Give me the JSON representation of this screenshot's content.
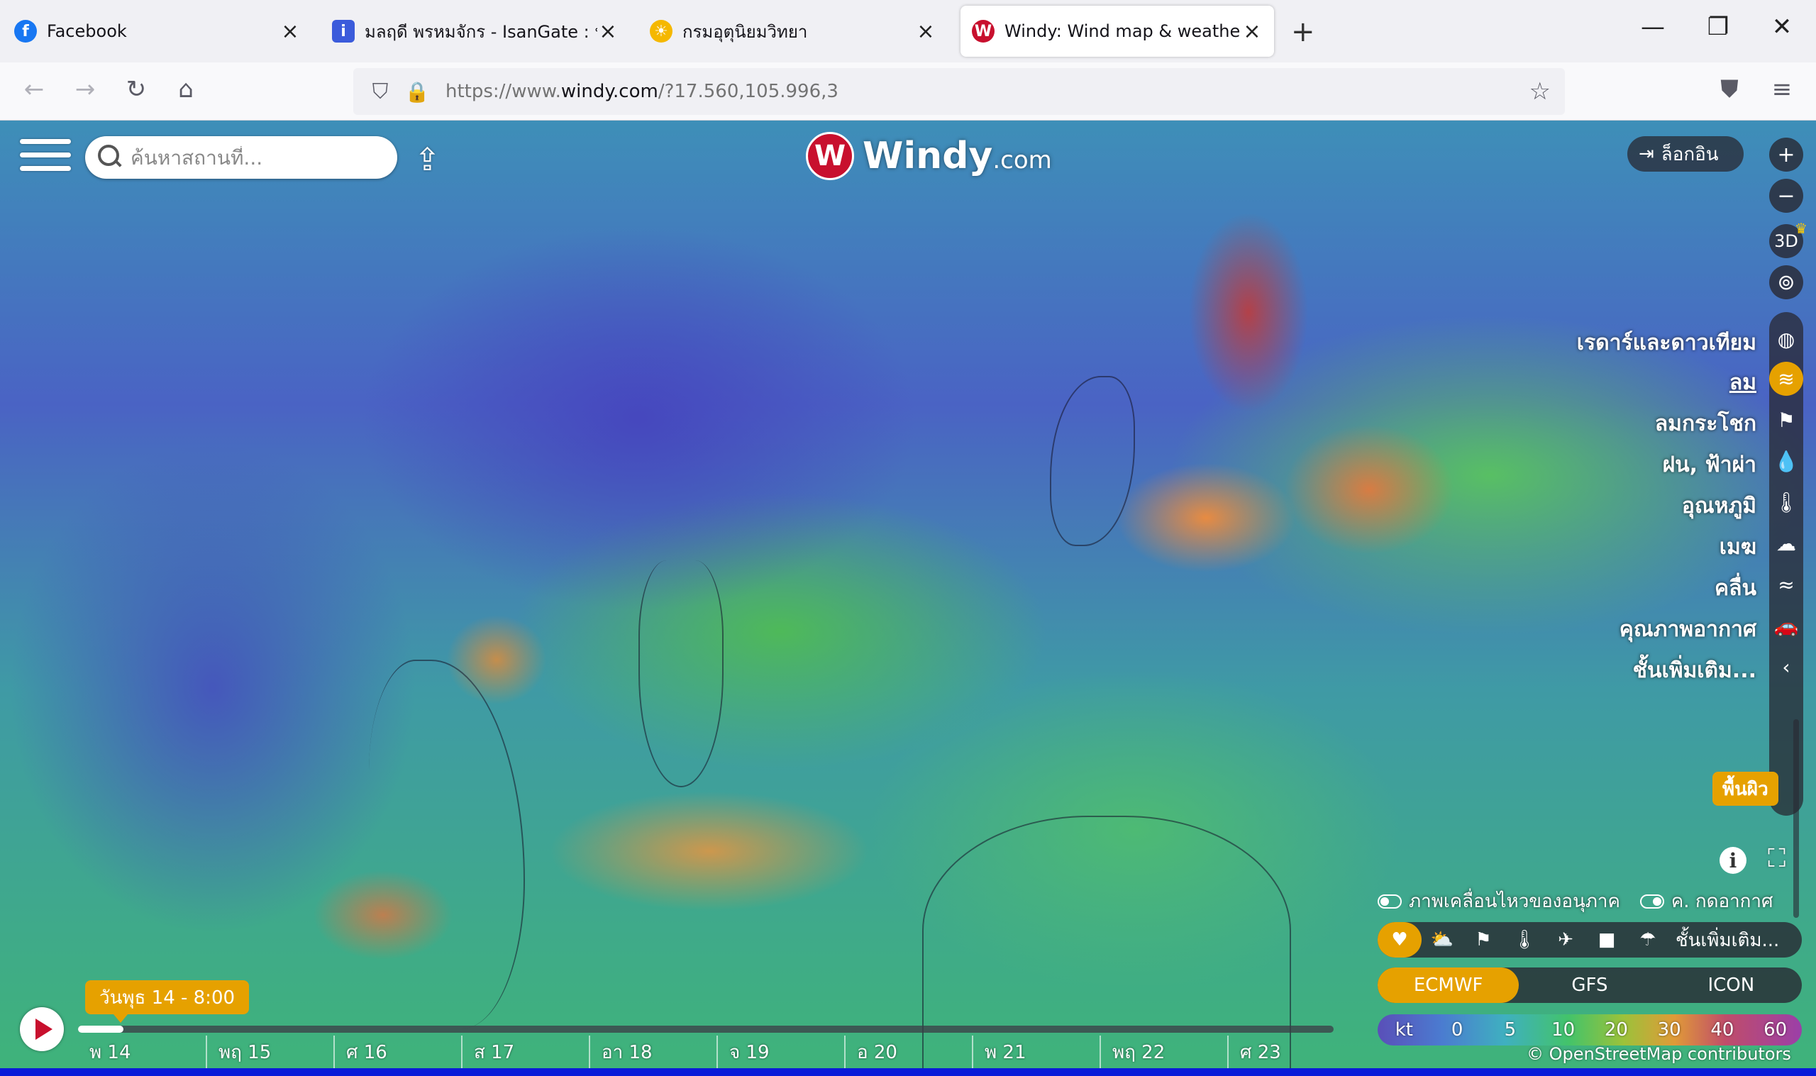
{
  "browser": {
    "tabs": [
      {
        "label": "Facebook",
        "favicon": "facebook-icon",
        "color": "#1877f2"
      },
      {
        "label": "มลฤดี พรหมจักร - IsanGate : ประ",
        "favicon": "isangate-icon",
        "color": "#3b5bdb"
      },
      {
        "label": "กรมอุตุนิยมวิทยา",
        "favicon": "sun-icon",
        "color": "#f5b800"
      },
      {
        "label": "Windy: Wind map & weather fo",
        "favicon": "windy-icon",
        "color": "#c8102e"
      }
    ],
    "url_prefix": "https://www.",
    "url_domain": "windy.com",
    "url_suffix": "/?17.560,105.996,3"
  },
  "map": {
    "search_placeholder": "ค้นหาสถานที่...",
    "logo_text": "Windy",
    "logo_suffix": ".com",
    "login_label": "ล็อกอิน",
    "btn_3d": "3D",
    "layers": [
      {
        "label": "เรดาร์และดาวเทียม",
        "icon": "globe-icon"
      },
      {
        "label": "ลม",
        "icon": "wind-icon",
        "selected": true
      },
      {
        "label": "ลมกระโชก",
        "icon": "flag-icon"
      },
      {
        "label": "ฝน, ฟ้าผ่า",
        "icon": "drop-icon"
      },
      {
        "label": "อุณหภูมิ",
        "icon": "thermometer-icon"
      },
      {
        "label": "เมฆ",
        "icon": "cloud-icon"
      },
      {
        "label": "คลื่น",
        "icon": "waves-icon"
      },
      {
        "label": "คุณภาพอากาศ",
        "icon": "car-icon"
      },
      {
        "label": "ชั้นเพิ่มเติม...",
        "icon": "chevron-left-icon"
      }
    ],
    "altitude_label": "พื้นผิว",
    "toggle_particles": "ภาพเคลื่อนไหวของอนุภาค",
    "toggle_pressure": "ค. กดอากาศ",
    "quick_more": "ชั้นเพิ่มเติม...",
    "models": [
      "ECMWF",
      "GFS",
      "ICON"
    ],
    "legend_unit": "kt",
    "legend_values": [
      "0",
      "5",
      "10",
      "20",
      "30",
      "40",
      "60"
    ],
    "attribution": "© OpenStreetMap contributors",
    "time_label": "วันพุธ 14 - 8:00",
    "days": [
      "พ 14",
      "พฤ 15",
      "ศ 16",
      "ส 17",
      "อา 18",
      "จ 19",
      "อ 20",
      "พ 21",
      "พฤ 22",
      "ศ 23"
    ]
  }
}
